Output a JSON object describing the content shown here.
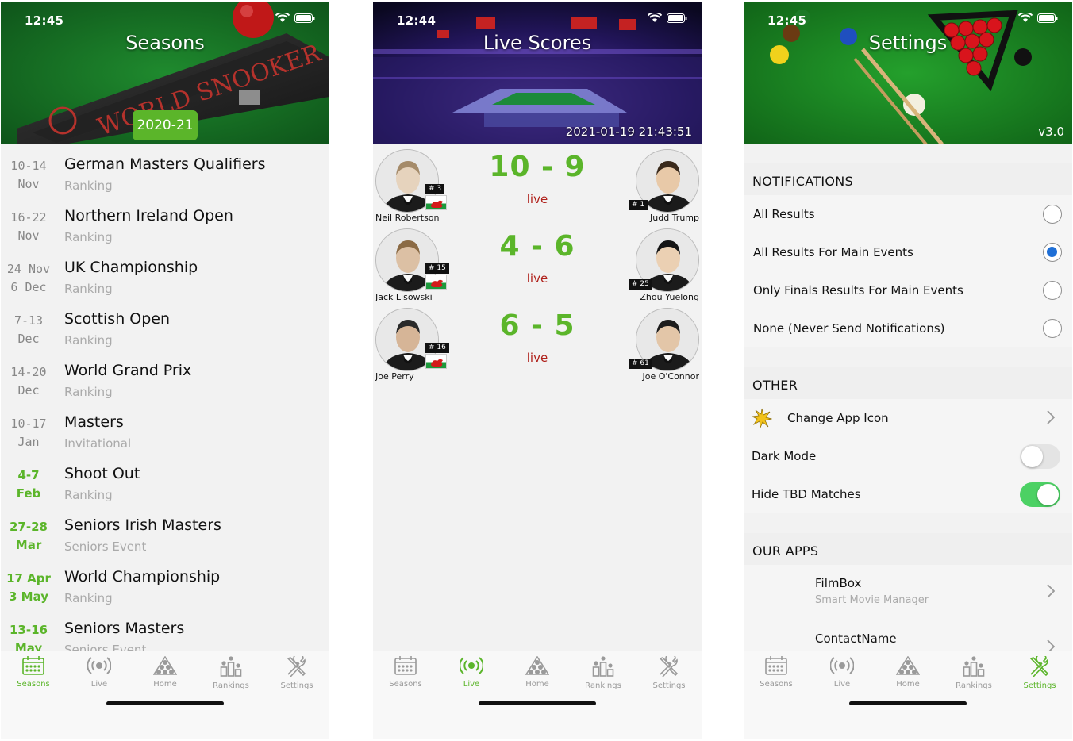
{
  "status": {
    "time1": "12:45",
    "time2": "12:44",
    "time3": "12:45"
  },
  "seasons": {
    "title": "Seasons",
    "season_label": "2020-21",
    "events": [
      {
        "d1": "10-14",
        "d2": "Nov",
        "name": "German Masters Qualifiers",
        "type": "Ranking",
        "upcoming": false
      },
      {
        "d1": "16-22",
        "d2": "Nov",
        "name": "Northern Ireland Open",
        "type": "Ranking",
        "upcoming": false
      },
      {
        "d1": "24 Nov",
        "d2": "6 Dec",
        "name": "UK Championship",
        "type": "Ranking",
        "upcoming": false
      },
      {
        "d1": "7-13",
        "d2": "Dec",
        "name": "Scottish Open",
        "type": "Ranking",
        "upcoming": false
      },
      {
        "d1": "14-20",
        "d2": "Dec",
        "name": "World Grand Prix",
        "type": "Ranking",
        "upcoming": false
      },
      {
        "d1": "10-17",
        "d2": "Jan",
        "name": "Masters",
        "type": "Invitational",
        "upcoming": false
      },
      {
        "d1": "4-7",
        "d2": "Feb",
        "name": "Shoot Out",
        "type": "Ranking",
        "upcoming": true
      },
      {
        "d1": "27-28",
        "d2": "Mar",
        "name": "Seniors Irish Masters",
        "type": "Seniors Event",
        "upcoming": true
      },
      {
        "d1": "17 Apr",
        "d2": "3 May",
        "name": "World Championship",
        "type": "Ranking",
        "upcoming": true
      },
      {
        "d1": "13-16",
        "d2": "May",
        "name": "Seniors Masters",
        "type": "Seniors Event",
        "upcoming": true
      }
    ]
  },
  "live": {
    "title": "Live Scores",
    "timestamp": "2021-01-19 21:43:51",
    "matches": [
      {
        "p1": "Neil Robertson",
        "r1": "# 3",
        "p2": "Judd Trump",
        "r2": "# 1",
        "score": "10 - 9",
        "status": "live"
      },
      {
        "p1": "Jack Lisowski",
        "r1": "# 15",
        "p2": "Zhou Yuelong",
        "r2": "# 25",
        "score": "4 - 6",
        "status": "live"
      },
      {
        "p1": "Joe Perry",
        "r1": "# 16",
        "p2": "Joe O'Connor",
        "r2": "# 61",
        "score": "6 - 5",
        "status": "live"
      }
    ]
  },
  "settings": {
    "title": "Settings",
    "version": "v3.0",
    "notifications_header": "NOTIFICATIONS",
    "notification_options": [
      {
        "label": "All Results",
        "checked": false
      },
      {
        "label": "All Results For Main Events",
        "checked": true
      },
      {
        "label": "Only Finals Results For Main Events",
        "checked": false
      },
      {
        "label": "None (Never Send Notifications)",
        "checked": false
      }
    ],
    "other_header": "OTHER",
    "change_icon_label": "Change App Icon",
    "dark_mode_label": "Dark Mode",
    "dark_mode_on": false,
    "hide_tbd_label": "Hide TBD Matches",
    "hide_tbd_on": true,
    "apps_header": "OUR APPS",
    "apps": [
      {
        "name": "FilmBox",
        "desc": "Smart Movie Manager"
      },
      {
        "name": "ContactName",
        "desc": ""
      }
    ]
  },
  "tabs": [
    "Seasons",
    "Live",
    "Home",
    "Rankings",
    "Settings"
  ],
  "colors": {
    "accent": "#5bb52a",
    "live": "#b0221c",
    "radio": "#1f6fd6",
    "toggle_on": "#4cd164"
  }
}
